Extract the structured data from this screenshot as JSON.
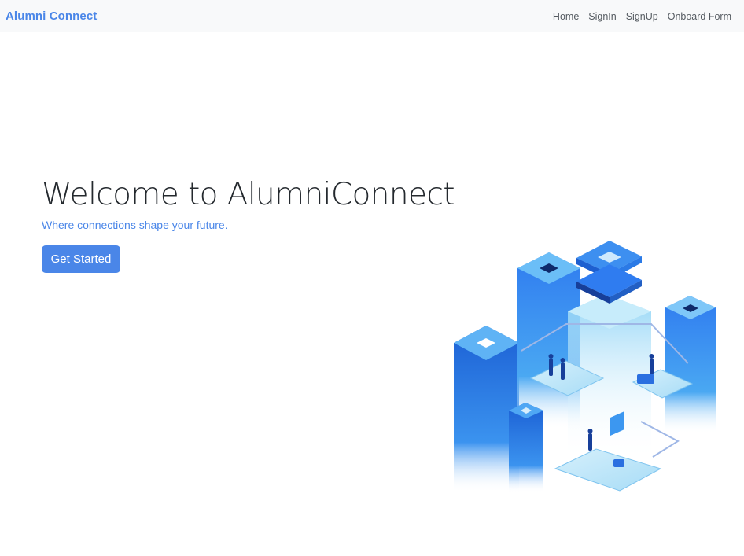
{
  "navbar": {
    "brand": "Alumni Connect",
    "links": [
      {
        "label": "Home"
      },
      {
        "label": "SignIn"
      },
      {
        "label": "SignUp"
      },
      {
        "label": "Onboard Form"
      }
    ]
  },
  "hero": {
    "title": "Welcome to AlumniConnect",
    "subtitle": "Where connections shape your future.",
    "cta_label": "Get Started"
  },
  "colors": {
    "accent": "#4a86e8",
    "navbar_bg": "#f8f9fa",
    "title_text": "#24292e"
  },
  "illustration": {
    "icon": "isometric-city-network-illustration"
  }
}
